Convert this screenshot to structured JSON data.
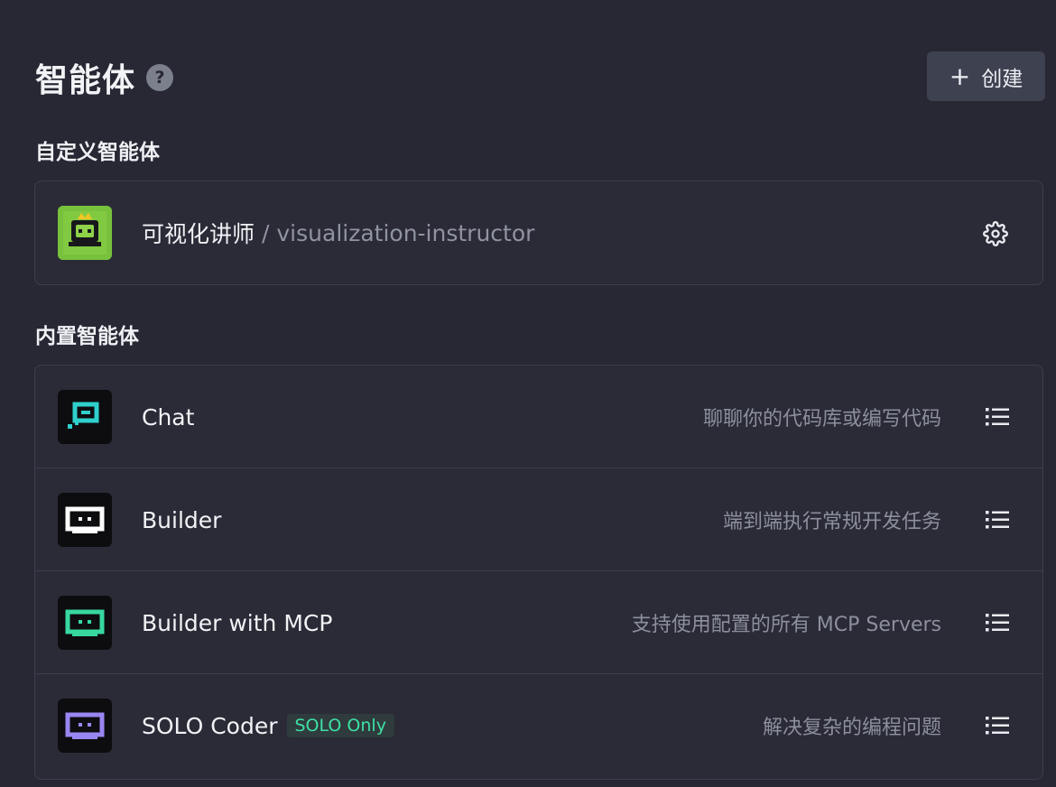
{
  "header": {
    "title": "智能体",
    "help_glyph": "?",
    "create_icon": "+",
    "create_label": "创建"
  },
  "custom_section": {
    "title": "自定义智能体",
    "items": [
      {
        "name": "可视化讲师",
        "slug": "/ visualization-instructor",
        "icon": "robot-crown-icon",
        "action_icon": "gear-icon"
      }
    ]
  },
  "builtin_section": {
    "title": "内置智能体",
    "items": [
      {
        "name": "Chat",
        "description": "聊聊你的代码库或编写代码",
        "icon": "chat-bubble-icon",
        "accent": "#2fd0cc",
        "action_icon": "list-icon"
      },
      {
        "name": "Builder",
        "description": "端到端执行常规开发任务",
        "icon": "builder-icon",
        "accent": "#ffffff",
        "action_icon": "list-icon"
      },
      {
        "name": "Builder with MCP",
        "description": "支持使用配置的所有 MCP Servers",
        "icon": "builder-mcp-icon",
        "accent": "#37d8a0",
        "action_icon": "list-icon"
      },
      {
        "name": "SOLO Coder",
        "badge": "SOLO Only",
        "description": "解决复杂的编程问题",
        "icon": "solo-coder-icon",
        "accent": "#9a86f2",
        "action_icon": "list-icon"
      }
    ]
  },
  "colors": {
    "background": "#272834",
    "panel_border": "#3b3e4b",
    "badge_text": "#3ee0a5"
  }
}
